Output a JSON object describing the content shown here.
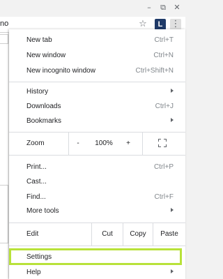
{
  "window": {
    "minimize": "–",
    "maximize": "⧉",
    "close": "✕"
  },
  "address_bar": {
    "fragment": "no",
    "star": "☆",
    "extension_letter": "L",
    "menu": "⋮"
  },
  "menu": {
    "group1": [
      {
        "label": "New tab",
        "shortcut": "Ctrl+T"
      },
      {
        "label": "New window",
        "shortcut": "Ctrl+N"
      },
      {
        "label": "New incognito window",
        "shortcut": "Ctrl+Shift+N"
      }
    ],
    "group2": [
      {
        "label": "History",
        "submenu": true
      },
      {
        "label": "Downloads",
        "shortcut": "Ctrl+J"
      },
      {
        "label": "Bookmarks",
        "submenu": true
      }
    ],
    "zoom": {
      "label": "Zoom",
      "minus": "-",
      "value": "100%",
      "plus": "+"
    },
    "group3": [
      {
        "label": "Print...",
        "shortcut": "Ctrl+P"
      },
      {
        "label": "Cast..."
      },
      {
        "label": "Find...",
        "shortcut": "Ctrl+F"
      },
      {
        "label": "More tools",
        "submenu": true
      }
    ],
    "edit": {
      "label": "Edit",
      "cut": "Cut",
      "copy": "Copy",
      "paste": "Paste"
    },
    "settings": {
      "label": "Settings"
    },
    "help": {
      "label": "Help",
      "submenu": true
    },
    "highlight_color": "#b8e23a"
  }
}
